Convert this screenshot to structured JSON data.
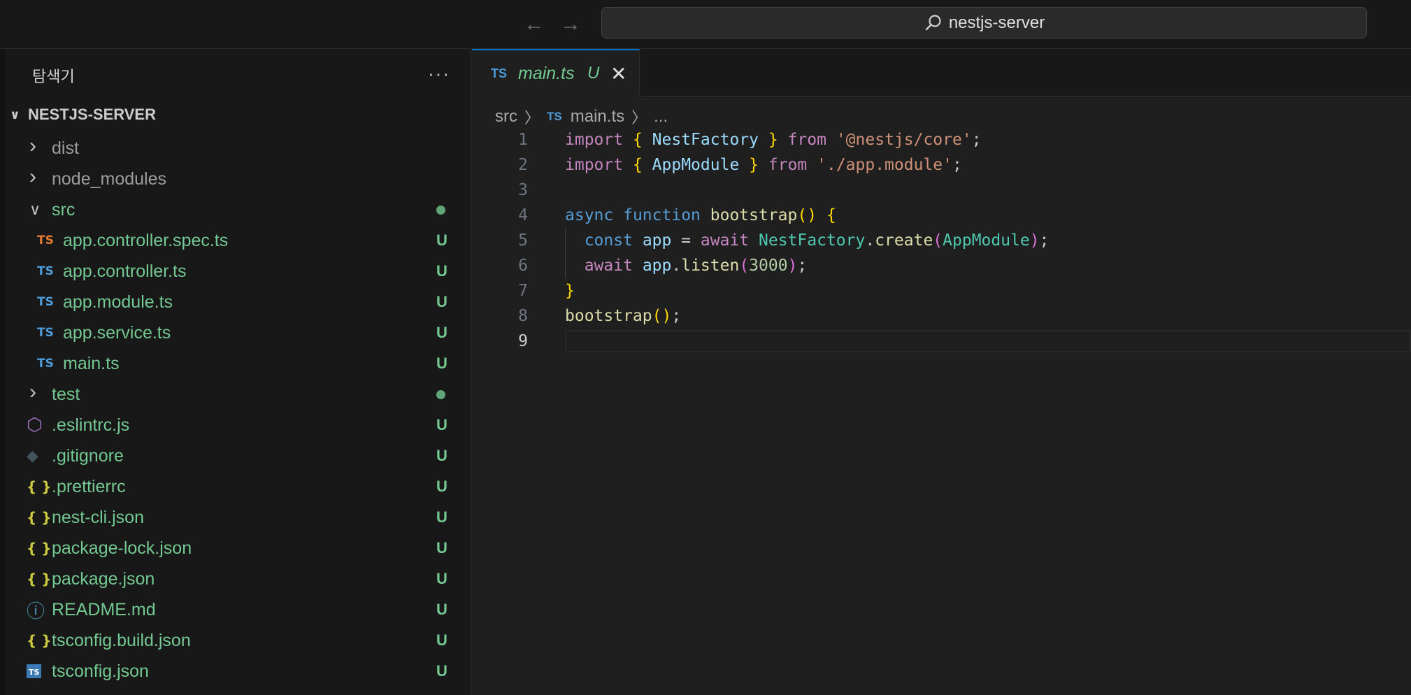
{
  "titlebar": {
    "back_icon": "arrow-left-icon",
    "forward_icon": "arrow-right-icon",
    "search_text": "nestjs-server",
    "search_icon": "search-icon"
  },
  "sidebar": {
    "title": "탐색기",
    "more_label": "···",
    "root_label": "NESTJS-SERVER",
    "items": [
      {
        "label": "dist",
        "type": "folder",
        "expanded": false,
        "badge": "",
        "color": "#9d9d9d"
      },
      {
        "label": "node_modules",
        "type": "folder",
        "expanded": false,
        "badge": "",
        "color": "#9d9d9d"
      },
      {
        "label": "src",
        "type": "folder",
        "expanded": true,
        "badge": "dot",
        "color": "#73c991"
      },
      {
        "label": "app.controller.spec.ts",
        "type": "ts-spec",
        "badge": "U",
        "icon_text": "TS",
        "color": "#73c991"
      },
      {
        "label": "app.controller.ts",
        "type": "ts",
        "badge": "U",
        "icon_text": "TS",
        "color": "#73c991"
      },
      {
        "label": "app.module.ts",
        "type": "ts",
        "badge": "U",
        "icon_text": "TS",
        "color": "#73c991"
      },
      {
        "label": "app.service.ts",
        "type": "ts",
        "badge": "U",
        "icon_text": "TS",
        "color": "#73c991"
      },
      {
        "label": "main.ts",
        "type": "ts",
        "badge": "U",
        "icon_text": "TS",
        "color": "#73c991"
      },
      {
        "label": "test",
        "type": "folder",
        "expanded": false,
        "badge": "dot",
        "color": "#73c991"
      },
      {
        "label": ".eslintrc.js",
        "type": "eslint",
        "badge": "U",
        "color": "#73c991"
      },
      {
        "label": ".gitignore",
        "type": "git",
        "badge": "U",
        "color": "#73c991"
      },
      {
        "label": ".prettierrc",
        "type": "json",
        "badge": "U",
        "icon_text": "{}",
        "color": "#73c991"
      },
      {
        "label": "nest-cli.json",
        "type": "json",
        "badge": "U",
        "icon_text": "{}",
        "color": "#73c991"
      },
      {
        "label": "package-lock.json",
        "type": "json",
        "badge": "U",
        "icon_text": "{}",
        "color": "#73c991"
      },
      {
        "label": "package.json",
        "type": "json",
        "badge": "U",
        "icon_text": "{}",
        "color": "#73c991"
      },
      {
        "label": "README.md",
        "type": "info",
        "badge": "U",
        "color": "#73c991"
      },
      {
        "label": "tsconfig.build.json",
        "type": "json",
        "badge": "U",
        "icon_text": "{}",
        "color": "#73c991"
      },
      {
        "label": "tsconfig.json",
        "type": "tsconfig",
        "badge": "U",
        "icon_text": "TS",
        "color": "#73c991"
      }
    ]
  },
  "editor": {
    "tab": {
      "icon_text": "TS",
      "name": "main.ts",
      "badge": "U",
      "close": "✕"
    },
    "breadcrumb": {
      "folder": "src",
      "sep": "〉",
      "file_icon": "TS",
      "file": "main.ts",
      "more": "..."
    },
    "lines": [
      {
        "n": "1",
        "tokens": [
          [
            "kw",
            "import"
          ],
          [
            "p",
            " "
          ],
          [
            "br1",
            "{"
          ],
          [
            "p",
            " "
          ],
          [
            "var",
            "NestFactory"
          ],
          [
            "p",
            " "
          ],
          [
            "br1",
            "}"
          ],
          [
            "p",
            " "
          ],
          [
            "kw",
            "from"
          ],
          [
            "p",
            " "
          ],
          [
            "str",
            "'@nestjs/core'"
          ],
          [
            "p",
            ";"
          ]
        ]
      },
      {
        "n": "2",
        "tokens": [
          [
            "kw",
            "import"
          ],
          [
            "p",
            " "
          ],
          [
            "br1",
            "{"
          ],
          [
            "p",
            " "
          ],
          [
            "var",
            "AppModule"
          ],
          [
            "p",
            " "
          ],
          [
            "br1",
            "}"
          ],
          [
            "p",
            " "
          ],
          [
            "kw",
            "from"
          ],
          [
            "p",
            " "
          ],
          [
            "str",
            "'./app.module'"
          ],
          [
            "p",
            ";"
          ]
        ]
      },
      {
        "n": "3",
        "tokens": []
      },
      {
        "n": "4",
        "tokens": [
          [
            "kwb",
            "async"
          ],
          [
            "p",
            " "
          ],
          [
            "kwb",
            "function"
          ],
          [
            "p",
            " "
          ],
          [
            "fn",
            "bootstrap"
          ],
          [
            "br1",
            "()"
          ],
          [
            "p",
            " "
          ],
          [
            "br1",
            "{"
          ]
        ]
      },
      {
        "n": "5",
        "tokens": [
          [
            "p",
            "  "
          ],
          [
            "kwb",
            "const"
          ],
          [
            "p",
            " "
          ],
          [
            "var",
            "app"
          ],
          [
            "p",
            " = "
          ],
          [
            "kw",
            "await"
          ],
          [
            "p",
            " "
          ],
          [
            "cls",
            "NestFactory"
          ],
          [
            "p",
            "."
          ],
          [
            "fn",
            "create"
          ],
          [
            "br2",
            "("
          ],
          [
            "cls",
            "AppModule"
          ],
          [
            "br2",
            ")"
          ],
          [
            "p",
            ";"
          ]
        ]
      },
      {
        "n": "6",
        "tokens": [
          [
            "p",
            "  "
          ],
          [
            "kw",
            "await"
          ],
          [
            "p",
            " "
          ],
          [
            "var",
            "app"
          ],
          [
            "p",
            "."
          ],
          [
            "fn",
            "listen"
          ],
          [
            "br2",
            "("
          ],
          [
            "num",
            "3000"
          ],
          [
            "br2",
            ")"
          ],
          [
            "p",
            ";"
          ]
        ]
      },
      {
        "n": "7",
        "tokens": [
          [
            "br1",
            "}"
          ]
        ]
      },
      {
        "n": "8",
        "tokens": [
          [
            "fn",
            "bootstrap"
          ],
          [
            "br1",
            "()"
          ],
          [
            "p",
            ";"
          ]
        ]
      },
      {
        "n": "9",
        "tokens": [],
        "current": true
      }
    ]
  }
}
